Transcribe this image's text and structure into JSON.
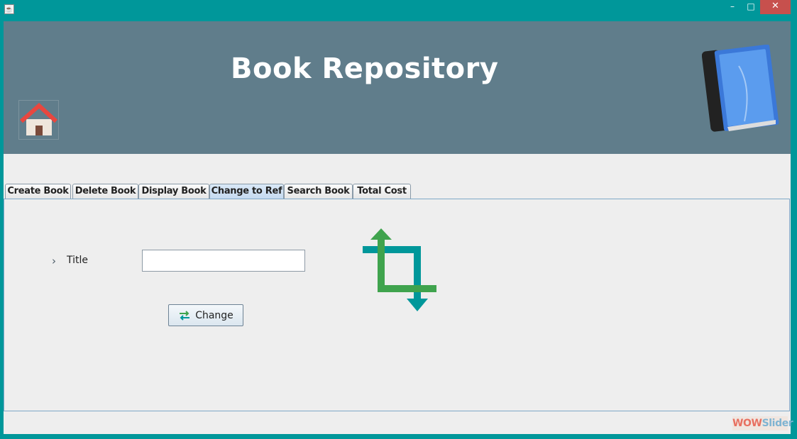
{
  "window": {
    "controls": {
      "minimize": "–",
      "maximize": "□",
      "close": "✕"
    },
    "app_icon": "java-cup-icon"
  },
  "header": {
    "title": "Book Repository",
    "home_icon": "house-icon",
    "logo_icon": "blue-book-icon",
    "background": "#607d8b"
  },
  "tabs": [
    {
      "label": "Create Book",
      "active": false
    },
    {
      "label": "Delete Book",
      "active": false
    },
    {
      "label": "Display Book",
      "active": false
    },
    {
      "label": "Change to Ref",
      "active": true
    },
    {
      "label": "Search Book",
      "active": false
    },
    {
      "label": "Total Cost",
      "active": false
    }
  ],
  "form": {
    "title_label": "Title",
    "title_value": "",
    "title_placeholder": "",
    "change_button": "Change",
    "change_icon": "swap-arrows-icon",
    "illustration_icon": "crop-icon"
  },
  "watermark": {
    "part1": "WOW",
    "part2": "Slider"
  },
  "colors": {
    "window_border": "#00979a",
    "accent_green": "#3fa34d",
    "accent_teal": "#00979a"
  }
}
